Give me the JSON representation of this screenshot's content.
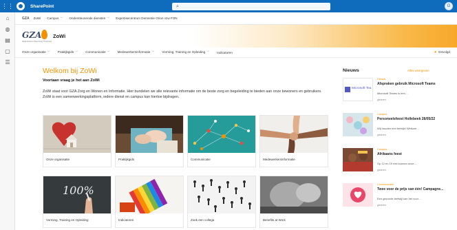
{
  "suitebar": {
    "app_name": "SharePoint",
    "search_placeholder": "Zoeken",
    "account_initial": "G"
  },
  "apprail": {
    "icons": [
      "home-icon",
      "globe-icon",
      "news-icon",
      "files-icon",
      "lists-icon"
    ]
  },
  "hubnav": {
    "logo": "GZA",
    "items": [
      {
        "label": "ZoWi",
        "has_menu": false
      },
      {
        "label": "Campus",
        "has_menu": true
      },
      {
        "label": "Ondersteunende diensten",
        "has_menu": true
      },
      {
        "label": "Expertisecentrum Dementie Orion vzw FON",
        "has_menu": false
      }
    ]
  },
  "header": {
    "logo_text": "GZA",
    "logo_subtext": "Ziekenhuizen Woonzorg Thuiszorg",
    "site_title": "ZoWi",
    "accent": "#f39200"
  },
  "sitenav": {
    "items": [
      {
        "label": "Onze organisatie",
        "has_menu": true
      },
      {
        "label": "Praktijkgids",
        "has_menu": true
      },
      {
        "label": "Communicatie",
        "has_menu": true
      },
      {
        "label": "Medewerkersinformatie",
        "has_menu": true
      },
      {
        "label": "Vorming, Training en Opleiding",
        "has_menu": true
      },
      {
        "label": "Indicatoren",
        "has_menu": false
      }
    ],
    "following_label": "Gevolgd"
  },
  "main": {
    "title": "Welkom bij ZoWi",
    "subtitle": "Voortaan vraag je het aan ZoWi",
    "body": "ZoWi staat voor GZA Zorg en Wonen en Informatie. Hier bundelen we alle relevante informatie om de beste zorg en begeleiding te bieden aan onze bewoners en gebruikers. ZoWi is een samenwerkingsplatform, iedere dienst en campus kan hiertoe bijdragen.",
    "tiles": [
      {
        "label": "Onze organisatie"
      },
      {
        "label": "Praktijkgids"
      },
      {
        "label": "Communicatie"
      },
      {
        "label": "Medewerkersinformatie"
      },
      {
        "label": "Vorming, Training en Opleiding"
      },
      {
        "label": "Indicatoren"
      },
      {
        "label": "Zoek een collega"
      },
      {
        "label": "Benefits at Work"
      }
    ]
  },
  "news": {
    "title": "Nieuws",
    "see_all": "Alles weergeven",
    "items": [
      {
        "category": "Nieuws",
        "headline": "Afspraken gebruik Microsoft Teams",
        "desc": "Microsoft Teams is een…",
        "meta": "gisteren",
        "thumb_text": "Microsoft Tea"
      },
      {
        "category": "Campus",
        "headline": "Personeelsfeest Hollebeek 28/05/22",
        "desc": "Wij houden een feestje! Welkom…",
        "meta": "gisteren"
      },
      {
        "category": "Campus",
        "headline": "Afrikaans feest",
        "desc": "Op 12 en 19 mei kunnen onze…",
        "meta": "gisteren"
      },
      {
        "category": "Communicatie",
        "headline": "Twee voor de prijs van één! Campagne...",
        "desc": "Een gezonde leefstijl kan het voor…",
        "meta": "gisteren"
      }
    ]
  }
}
